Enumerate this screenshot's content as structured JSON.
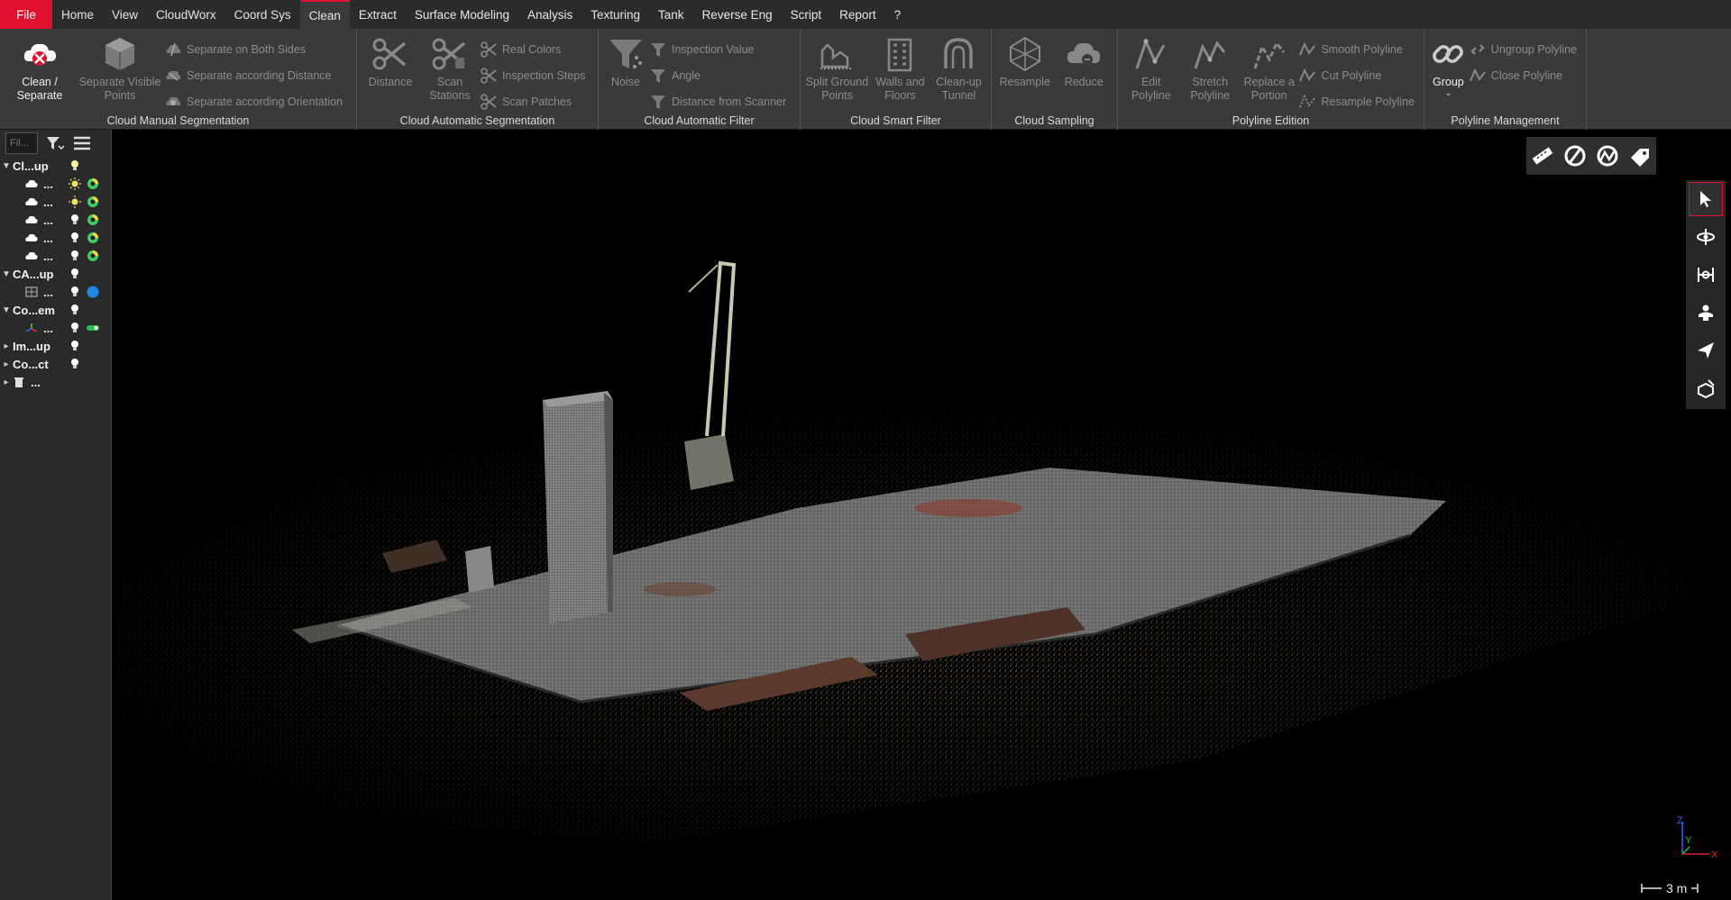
{
  "menu": {
    "items": [
      "File",
      "Home",
      "View",
      "CloudWorx",
      "Coord Sys",
      "Clean",
      "Extract",
      "Surface Modeling",
      "Analysis",
      "Texturing",
      "Tank",
      "Reverse Eng",
      "Script",
      "Report",
      "?"
    ],
    "active": "Clean"
  },
  "ribbon": {
    "manual_seg": {
      "title": "Cloud Manual Segmentation",
      "clean_separate": "Clean / Separate",
      "separate_visible": "Separate Visible Points",
      "both_sides": "Separate on Both Sides",
      "according_distance": "Separate according Distance",
      "according_orientation": "Separate according Orientation"
    },
    "auto_seg": {
      "title": "Cloud Automatic Segmentation",
      "distance": "Distance",
      "scan_stations": "Scan Stations",
      "real_colors": "Real Colors",
      "inspection_steps": "Inspection Steps",
      "scan_patches": "Scan Patches"
    },
    "auto_filter": {
      "title": "Cloud Automatic Filter",
      "noise": "Noise",
      "inspection_value": "Inspection Value",
      "angle": "Angle",
      "distance_scanner": "Distance from Scanner"
    },
    "smart_filter": {
      "title": "Cloud Smart Filter",
      "split_ground": "Split Ground Points",
      "walls_floors": "Walls and Floors",
      "cleanup_tunnel": "Clean-up Tunnel"
    },
    "sampling": {
      "title": "Cloud Sampling",
      "resample": "Resample",
      "reduce": "Reduce"
    },
    "polyline": {
      "title": "Polyline Edition",
      "edit": "Edit Polyline",
      "stretch": "Stretch Polyline",
      "replace": "Replace a Portion",
      "smooth": "Smooth Polyline",
      "cut": "Cut Polyline",
      "resample": "Resample Polyline"
    },
    "polyline_mgmt": {
      "title": "Polyline Management",
      "group": "Group",
      "ungroup": "Ungroup Polyline",
      "close": "Close Polyline"
    }
  },
  "tree": {
    "filter_placeholder": "Fil...",
    "groups": [
      {
        "label": "Cl...up",
        "expanded": true,
        "children": [
          "...",
          "...",
          "...",
          "...",
          "..."
        ]
      },
      {
        "label": "CA...up",
        "expanded": true,
        "children": [
          "..."
        ]
      },
      {
        "label": "Co...em",
        "expanded": true,
        "children": [
          "..."
        ]
      },
      {
        "label": "Im...up",
        "expanded": false,
        "children": []
      },
      {
        "label": "Co...ct",
        "expanded": false,
        "children": []
      },
      {
        "label": "...",
        "expanded": false,
        "children": []
      }
    ]
  },
  "viewport": {
    "scale_label": "3 m",
    "axis_labels": {
      "x": "X",
      "y": "Y",
      "z": "Z"
    }
  },
  "colors": {
    "accent": "#e0102f",
    "ribbon_bg": "#3a3a3a",
    "menubar_bg": "#2b2b2b",
    "panel_bg": "#2a2a2a"
  }
}
